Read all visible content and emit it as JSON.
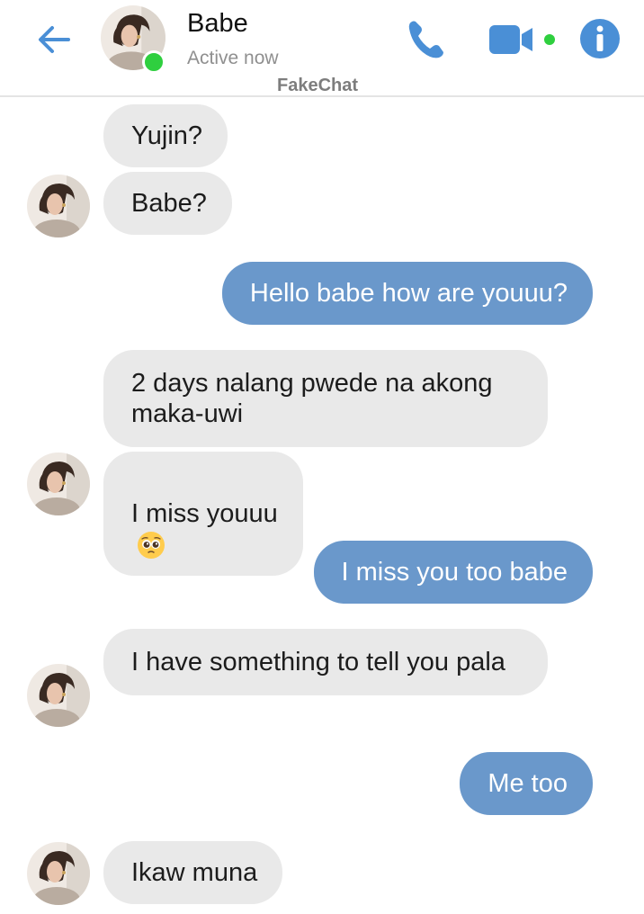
{
  "header": {
    "contact_name": "Babe",
    "status": "Active now",
    "brand": "FakeChat",
    "icons": [
      "back-arrow-icon",
      "phone-icon",
      "video-camera-icon",
      "info-icon"
    ],
    "accent_color": "#4a8fd6",
    "online_color": "#2fcf3f"
  },
  "messages": [
    {
      "from": "contact",
      "text": "Yujin?"
    },
    {
      "from": "contact",
      "text": "Babe?"
    },
    {
      "from": "me",
      "text": "Hello babe how are youuu?"
    },
    {
      "from": "contact",
      "text": "2 days nalang pwede na akong maka-uwi"
    },
    {
      "from": "contact",
      "text": "I miss youuu",
      "emoji": "pleading-face-icon"
    },
    {
      "from": "me",
      "text": "I miss you too babe"
    },
    {
      "from": "contact",
      "text": "I have something to tell you pala"
    },
    {
      "from": "me",
      "text": "Me too"
    },
    {
      "from": "contact",
      "text": "Ikaw muna"
    }
  ],
  "colors": {
    "incoming_bubble": "#e9e9e9",
    "outgoing_bubble": "#6a98cb"
  }
}
